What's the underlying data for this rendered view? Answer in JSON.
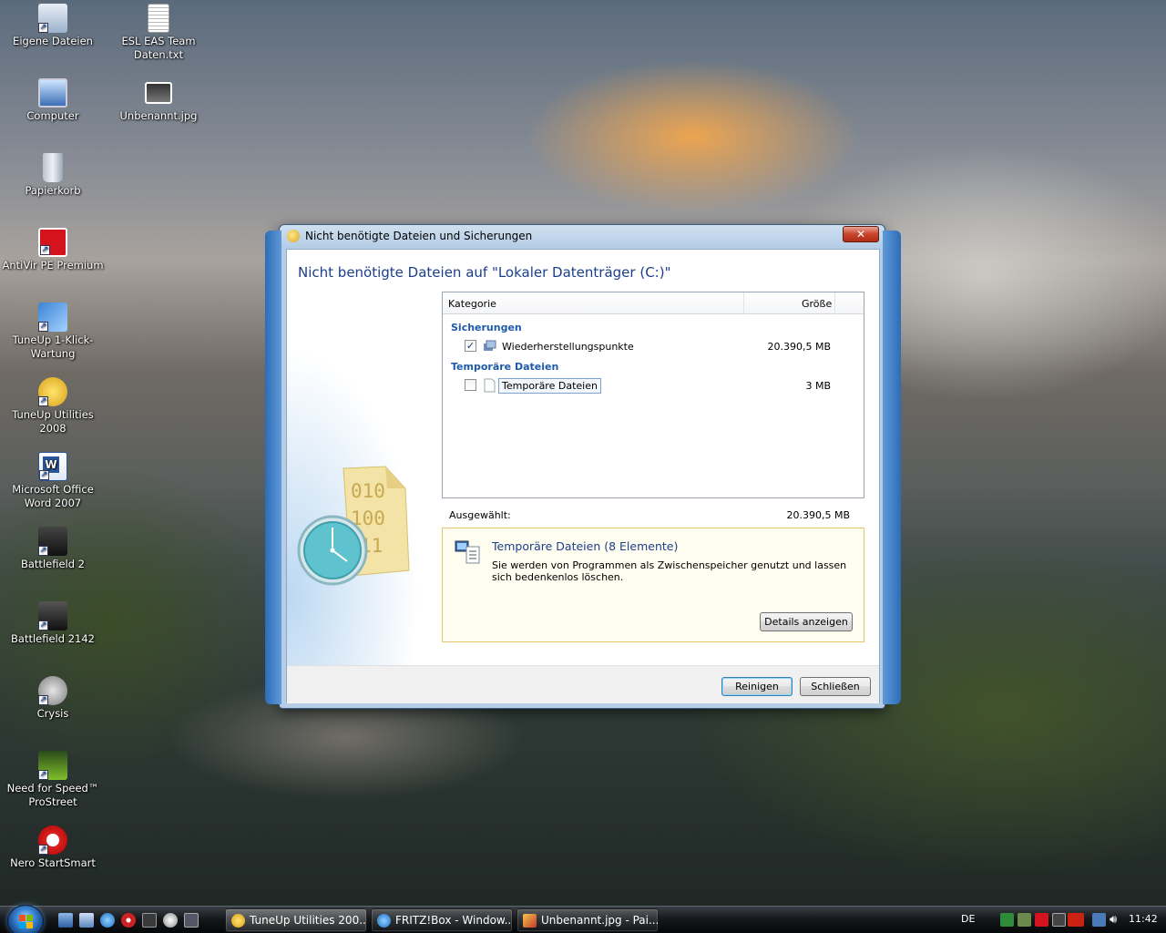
{
  "desktop": {
    "icons": [
      {
        "label": "Eigene Dateien",
        "icon": "user-folder-icon"
      },
      {
        "label": "ESL EAS Team Daten.txt",
        "icon": "text-file-icon"
      },
      {
        "label": "Computer",
        "icon": "computer-icon"
      },
      {
        "label": "Unbenannt.jpg",
        "icon": "image-file-icon"
      },
      {
        "label": "Papierkorb",
        "icon": "recycle-bin-icon"
      },
      {
        "label": "AntiVir PE Premium",
        "icon": "antivir-icon"
      },
      {
        "label": "TuneUp 1-Klick-Wartung",
        "icon": "tuneup-oneclick-icon"
      },
      {
        "label": "TuneUp Utilities 2008",
        "icon": "tuneup-icon"
      },
      {
        "label": "Microsoft Office Word 2007",
        "icon": "word-icon"
      },
      {
        "label": "Battlefield 2",
        "icon": "battlefield2-icon"
      },
      {
        "label": "Battlefield 2142",
        "icon": "battlefield2142-icon"
      },
      {
        "label": "Crysis",
        "icon": "crysis-icon"
      },
      {
        "label": "Need for Speed™ ProStreet",
        "icon": "nfs-icon"
      },
      {
        "label": "Nero StartSmart",
        "icon": "nero-icon"
      }
    ]
  },
  "dialog": {
    "title": "Nicht benötigte Dateien und Sicherungen",
    "close_label": "✕",
    "heading": "Nicht benötigte Dateien auf \"Lokaler Datenträger (C:)\"",
    "columns": {
      "category": "Kategorie",
      "size": "Größe"
    },
    "groups": [
      {
        "name": "Sicherungen",
        "items": [
          {
            "label": "Wiederherstellungspunkte",
            "size": "20.390,5 MB",
            "checked": true,
            "icon": "restore-point-icon"
          }
        ]
      },
      {
        "name": "Temporäre Dateien",
        "items": [
          {
            "label": "Temporäre Dateien",
            "size": "3 MB",
            "checked": false,
            "icon": "temp-file-icon"
          }
        ]
      }
    ],
    "selected_label": "Ausgewählt:",
    "selected_value": "20.390,5 MB",
    "info": {
      "title": "Temporäre Dateien (8 Elemente)",
      "description": "Sie werden von Programmen als Zwischenspeicher genutzt und lassen sich bedenkenlos löschen.",
      "details_button": "Details anzeigen"
    },
    "buttons": {
      "clean": "Reinigen",
      "close": "Schließen"
    },
    "art_digits": "010\n100\n11"
  },
  "taskbar": {
    "tasks": [
      {
        "label": "TuneUp Utilities 200...",
        "icon": "tuneup-icon",
        "active": true
      },
      {
        "label": "FRITZ!Box - Window...",
        "icon": "internet-explorer-icon",
        "active": false
      },
      {
        "label": "Unbenannt.jpg - Pai...",
        "icon": "paint-icon",
        "active": false
      }
    ],
    "language": "DE",
    "clock": "11:42"
  },
  "colors": {
    "accent": "#1b3f8b",
    "group_label": "#1d5aa7",
    "info_border": "#e3c56c"
  }
}
